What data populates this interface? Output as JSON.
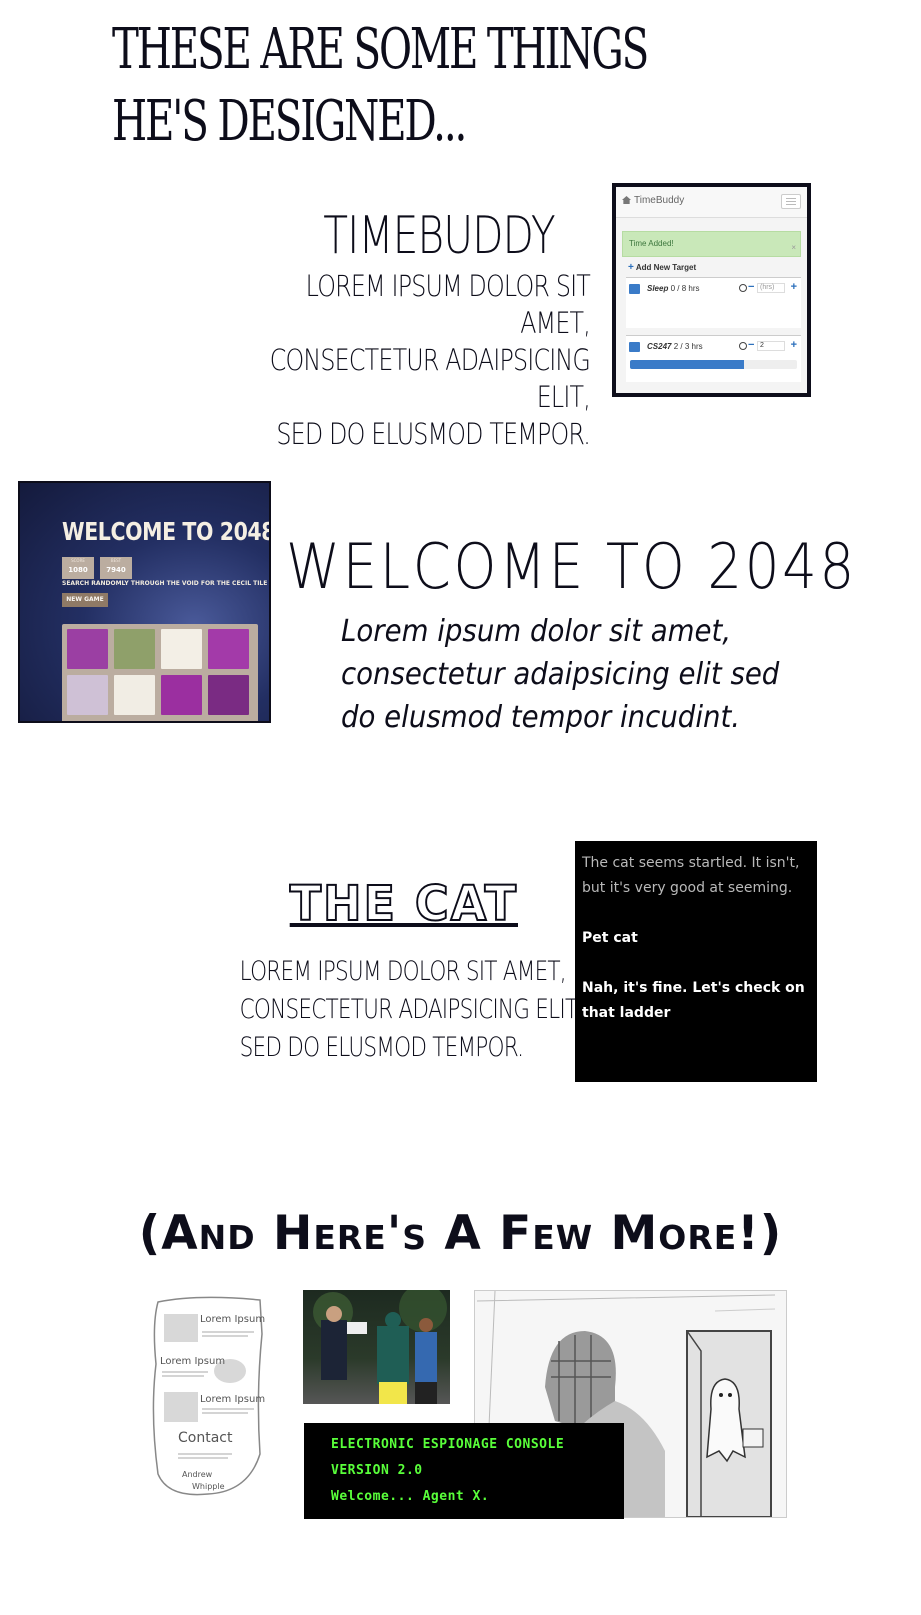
{
  "heading": {
    "line1": "These are some things",
    "line2": "he's designed..."
  },
  "timebuddy": {
    "title": "TimeBuddy",
    "desc": [
      "Lorem ipsum dolor sit amet,",
      "consectetur adaipsicing elit,",
      "sed do elusmod tempor."
    ],
    "screenshot": {
      "app_name": "TimeBuddy",
      "alert": "Time Added!",
      "alert_close": "×",
      "add_target": "Add New Target",
      "add_icon": "+",
      "targets": [
        {
          "name": "Sleep",
          "progress_text": "0 / 8 hrs",
          "input_placeholder": "(hrs)",
          "input_value": "",
          "progress": 0
        },
        {
          "name": "CS247",
          "progress_text": "2 / 3 hrs",
          "input_placeholder": "",
          "input_value": "2",
          "progress": 0.68
        }
      ],
      "minus": "−",
      "plus": "+"
    }
  },
  "game2048": {
    "title": "Welcome to 2048",
    "desc": [
      "Lorem ipsum dolor sit amet,",
      "consectetur adaipsicing elit sed",
      "do elusmod tempor incudint."
    ],
    "screenshot": {
      "title": "WELCOME TO 2048",
      "score_label": "SCORE",
      "score": "1080",
      "best_label": "BEST",
      "best": "7940",
      "subtitle": "SEARCH RANDOMLY THROUGH THE VOID FOR THE CECIL TILE",
      "new_game": "NEW GAME"
    }
  },
  "the_cat": {
    "title": "The Cat",
    "desc": [
      "Lorem ipsum dolor sit amet,",
      "consectetur adaipsicing elit,",
      "sed do elusmod tempor."
    ],
    "screenshot": {
      "intro": "The cat seems startled. It isn't, but it's very good at seeming.",
      "choice1": "Pet cat",
      "choice2": "Nah, it's fine. Let's check on that ladder"
    }
  },
  "more": {
    "heading": "(And Here's A Few More!)",
    "sketch": {
      "item1": "Lorem Ipsum",
      "item2": "Lorem Ipsum",
      "item3": "Lorem Ipsum",
      "contact": "Contact",
      "name1": "Andrew",
      "name2": "Whipple"
    },
    "console": {
      "line1": "ELECTRONIC ESPIONAGE CONSOLE",
      "line2": "VERSION 2.0",
      "line3": "Welcome... Agent X."
    }
  },
  "colors": {
    "ink": "#0d0d1a",
    "console_green": "#59ff3a",
    "timebuddy_blue": "#3a7bc8"
  }
}
